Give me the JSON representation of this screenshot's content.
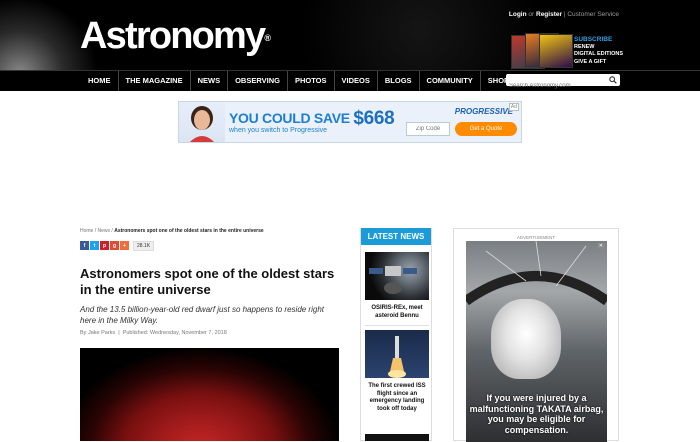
{
  "header": {
    "logo": "Astronomy",
    "logo_mark": "®",
    "login": "Login",
    "or": "or",
    "register": "Register",
    "customer_service": "Customer Service",
    "subscribe": "SUBSCRIBE",
    "sub_links": [
      "RENEW",
      "DIGITAL EDITIONS",
      "GIVE A GIFT"
    ]
  },
  "nav": {
    "items": [
      "HOME",
      "THE MAGAZINE",
      "NEWS",
      "OBSERVING",
      "PHOTOS",
      "VIDEOS",
      "BLOGS",
      "COMMUNITY",
      "SHOP"
    ],
    "search_placeholder": "Search Astronomy.com"
  },
  "ad": {
    "headline_pre": "YOU COULD SAVE",
    "headline_amount": "$668",
    "subline": "when you switch to Progressive",
    "brand": "PROGRESSIVE",
    "tag": "Ad",
    "zip_placeholder": "Zip Code",
    "cta": "Get a Quote"
  },
  "article": {
    "breadcrumb": [
      "Home",
      "News"
    ],
    "breadcrumb_current": "Astronomers spot one of the oldest stars in the entire universe",
    "share_count": "28.1K",
    "title": "Astronomers spot one of the oldest stars in the entire universe",
    "subtitle": "And the 13.5 billion-year-old red dwarf just so happens to reside right here in the Milky Way.",
    "author": "By Jake Parks",
    "published": "Published: Wednesday, November 7, 2018"
  },
  "latest_news": {
    "heading": "LATEST NEWS",
    "items": [
      {
        "caption": "OSIRIS-REx, meet asteroid Bennu"
      },
      {
        "caption": "The first crewed ISS flight since an emergency landing took off today"
      }
    ]
  },
  "right_ad": {
    "label": "ADVERTISEMENT",
    "text": "If you were injured by a malfunctioning TAKATA airbag, you may be eligible for compensation."
  },
  "colors": {
    "nav_bg": "#000000",
    "accent_blue": "#1b9bd7",
    "subscribe_blue": "#2e9fe6"
  }
}
